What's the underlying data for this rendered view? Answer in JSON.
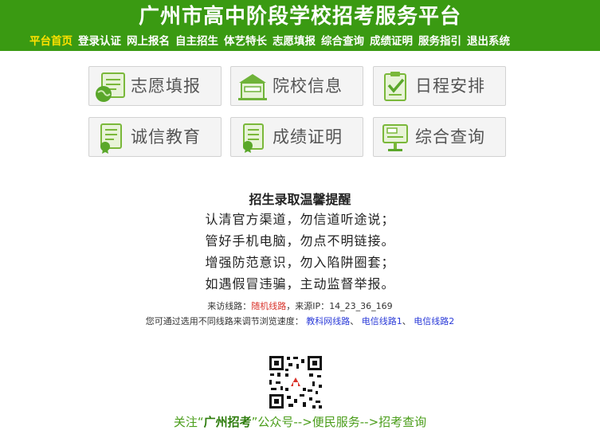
{
  "header": {
    "title": "广州市高中阶段学校招考服务平台",
    "nav": [
      {
        "label": "平台首页",
        "active": true
      },
      {
        "label": "登录认证",
        "active": false
      },
      {
        "label": "网上报名",
        "active": false
      },
      {
        "label": "自主招生",
        "active": false
      },
      {
        "label": "体艺特长",
        "active": false
      },
      {
        "label": "志愿填报",
        "active": false
      },
      {
        "label": "综合查询",
        "active": false
      },
      {
        "label": "成绩证明",
        "active": false
      },
      {
        "label": "服务指引",
        "active": false
      },
      {
        "label": "退出系统",
        "active": false
      }
    ]
  },
  "tiles": [
    {
      "label": "志愿填报",
      "icon": "globe-form-icon"
    },
    {
      "label": "院校信息",
      "icon": "school-building-icon"
    },
    {
      "label": "日程安排",
      "icon": "checklist-icon"
    },
    {
      "label": "诚信教育",
      "icon": "certificate-icon"
    },
    {
      "label": "成绩证明",
      "icon": "document-ribbon-icon"
    },
    {
      "label": "综合查询",
      "icon": "query-sign-icon"
    }
  ],
  "notice": {
    "title": "招生录取温馨提醒",
    "lines": [
      "认清官方渠道，勿信道听途说；",
      "管好手机电脑，勿点不明链接。",
      "增强防范意识，勿入陷阱圈套；",
      "如遇假冒违骗，主动监督举报。"
    ]
  },
  "visit": {
    "prefix": "来访线路：",
    "route": "随机线路",
    "ip_prefix": "，来源IP：",
    "ip": "14_23_36_169"
  },
  "speed": {
    "text": "您可通过选用不同线路来调节浏览速度：",
    "links": [
      "教科网线路",
      "电信线路1",
      "电信线路2"
    ],
    "sep1": "、",
    "sep2": "、"
  },
  "follow": {
    "prefix": "关注“",
    "account": "广州招考",
    "suffix": "”公众号-->便民服务-->招考查询"
  },
  "colors": {
    "header_bg": "#3a9a12",
    "nav_active": "#ffe100",
    "route": "#d9332b",
    "link": "#2a3ad8",
    "follow": "#4a9d1a"
  }
}
